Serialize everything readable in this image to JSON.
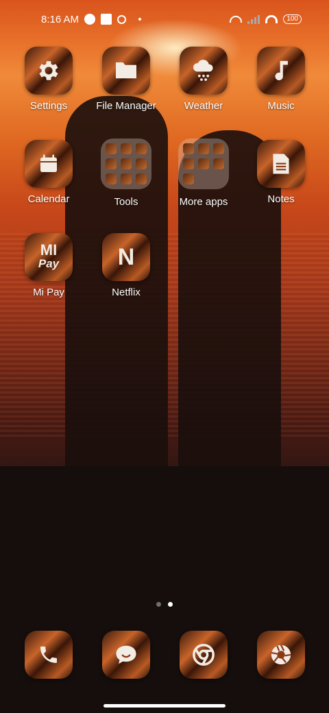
{
  "status_bar": {
    "time": "8:16 AM",
    "battery": "100"
  },
  "apps": [
    {
      "label": "Settings",
      "icon": "gear-icon"
    },
    {
      "label": "File Manager",
      "icon": "folder-icon"
    },
    {
      "label": "Weather",
      "icon": "cloud-snow-icon"
    },
    {
      "label": "Music",
      "icon": "music-note-icon"
    },
    {
      "label": "Calendar",
      "icon": "calendar-icon"
    },
    {
      "label": "Tools",
      "icon": "folder-grid"
    },
    {
      "label": "More apps",
      "icon": "folder-grid"
    },
    {
      "label": "Notes",
      "icon": "note-icon"
    },
    {
      "label": "Mi Pay",
      "icon": "mi-pay-icon"
    },
    {
      "label": "Netflix",
      "icon": "netflix-icon"
    }
  ],
  "mi_pay_text": "Pay",
  "netflix_letter": "N",
  "dock": [
    {
      "icon": "phone-icon"
    },
    {
      "icon": "message-icon"
    },
    {
      "icon": "chrome-icon"
    },
    {
      "icon": "camera-icon"
    }
  ],
  "page_indicator": {
    "pages": 2,
    "active": 2
  }
}
